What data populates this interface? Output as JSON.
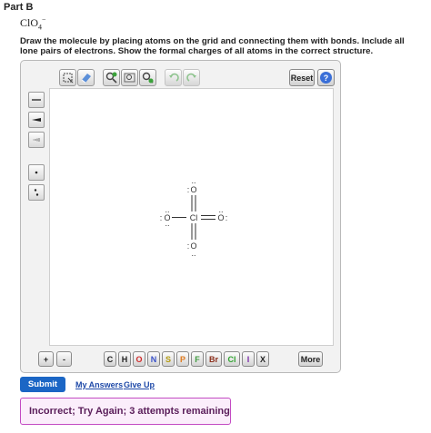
{
  "header": {
    "part_label": "Part B",
    "formula_main": "ClO",
    "formula_sub": "4",
    "formula_charge": "−"
  },
  "instructions": "Draw the molecule by placing atoms on the grid and connecting them with bonds. Include all lone pairs of electrons. Show the formal charges of all atoms in the correct structure.",
  "toolbar": {
    "reset_label": "Reset",
    "help_label": "?",
    "undo_icon": "undo-arrow",
    "redo_icon": "redo-arrow"
  },
  "molecule": {
    "center_atom": "Cl",
    "top_atom": "O",
    "bottom_atom": "O",
    "left_atom": "O",
    "right_atom": "O",
    "bonds": [
      "single-left",
      "double-top",
      "double-right",
      "double-bottom"
    ]
  },
  "bottom_bar": {
    "plus": "+",
    "minus": "-",
    "elements": [
      "C",
      "H",
      "O",
      "N",
      "S",
      "P",
      "F",
      "Br",
      "Cl",
      "I",
      "X"
    ],
    "element_colors": [
      "#222222",
      "#222222",
      "#d12b2b",
      "#3a52c9",
      "#b39b10",
      "#e07a1d",
      "#3f9a3f",
      "#8c2f1c",
      "#2fa32f",
      "#7a2aa8",
      "#222222"
    ],
    "more_label": "More"
  },
  "actions": {
    "submit_label": "Submit",
    "my_answers_label": "My Answers",
    "give_up_label": "Give Up"
  },
  "feedback": {
    "message": "Incorrect; Try Again; 3 attempts remaining"
  }
}
